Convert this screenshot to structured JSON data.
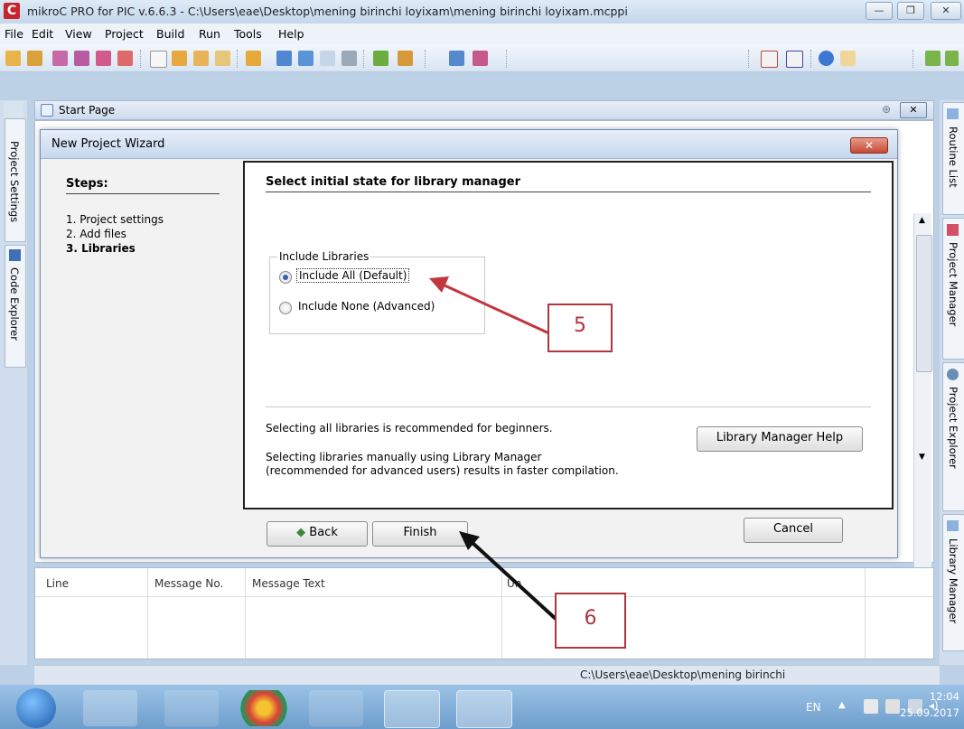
{
  "window": {
    "title": "mikroC PRO for PIC v.6.6.3 - C:\\Users\\eae\\Desktop\\mening birinchi loyixam\\mening birinchi loyixam.mcppi",
    "app_icon_letter": "C",
    "minimize": "—",
    "maximize": "❐",
    "close": "✕"
  },
  "menu": [
    "File",
    "Edit",
    "View",
    "Project",
    "Build",
    "Run",
    "Tools",
    "Help"
  ],
  "start_page": {
    "tab": "Start Page"
  },
  "left_dock": {
    "project_settings": "Project Settings",
    "code_explorer": "Code Explorer"
  },
  "right_dock": {
    "routine_list": "Routine List",
    "project_manager": "Project Manager",
    "project_explorer": "Project Explorer",
    "library_manager": "Library Manager"
  },
  "wizard": {
    "title": "New Project Wizard",
    "close": "✕",
    "steps_heading": "Steps:",
    "steps": [
      "1. Project settings",
      "2. Add files",
      "3. Libraries"
    ],
    "panel_heading": "Select initial state for library manager",
    "group_label": "Include Libraries",
    "option_all": "Include All (Default)",
    "option_none": "Include None (Advanced)",
    "note_1": "Selecting all libraries is recommended for beginners.",
    "note_2": "Selecting libraries manually using Library Manager",
    "note_3": "(recommended for advanced users) results in faster compilation.",
    "help_button": "Library Manager Help",
    "back_button": "Back",
    "finish_button": "Finish",
    "cancel_button": "Cancel"
  },
  "callouts": {
    "five": "5",
    "six": "6"
  },
  "messages": {
    "columns": [
      "Line",
      "Message No.",
      "Message Text",
      "Un"
    ]
  },
  "status": {
    "path": "C:\\Users\\eae\\Desktop\\mening birinchi"
  },
  "taskbar": {
    "language": "EN",
    "time": "12:04",
    "date": "25.09.2017"
  },
  "colors": {
    "callout": "#b0353d",
    "arrow_red": "#c2363d",
    "arrow_black": "#111111"
  }
}
